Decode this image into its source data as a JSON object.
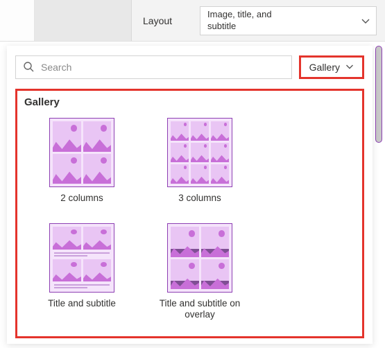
{
  "top": {
    "layout_label": "Layout",
    "layout_value": "Image, title, and subtitle"
  },
  "panel": {
    "search_placeholder": "Search",
    "filter_label": "Gallery",
    "section_title": "Gallery",
    "items": [
      {
        "label": "2 columns"
      },
      {
        "label": "3 columns"
      },
      {
        "label": "Title and subtitle"
      },
      {
        "label": "Title and subtitle on overlay"
      }
    ]
  }
}
